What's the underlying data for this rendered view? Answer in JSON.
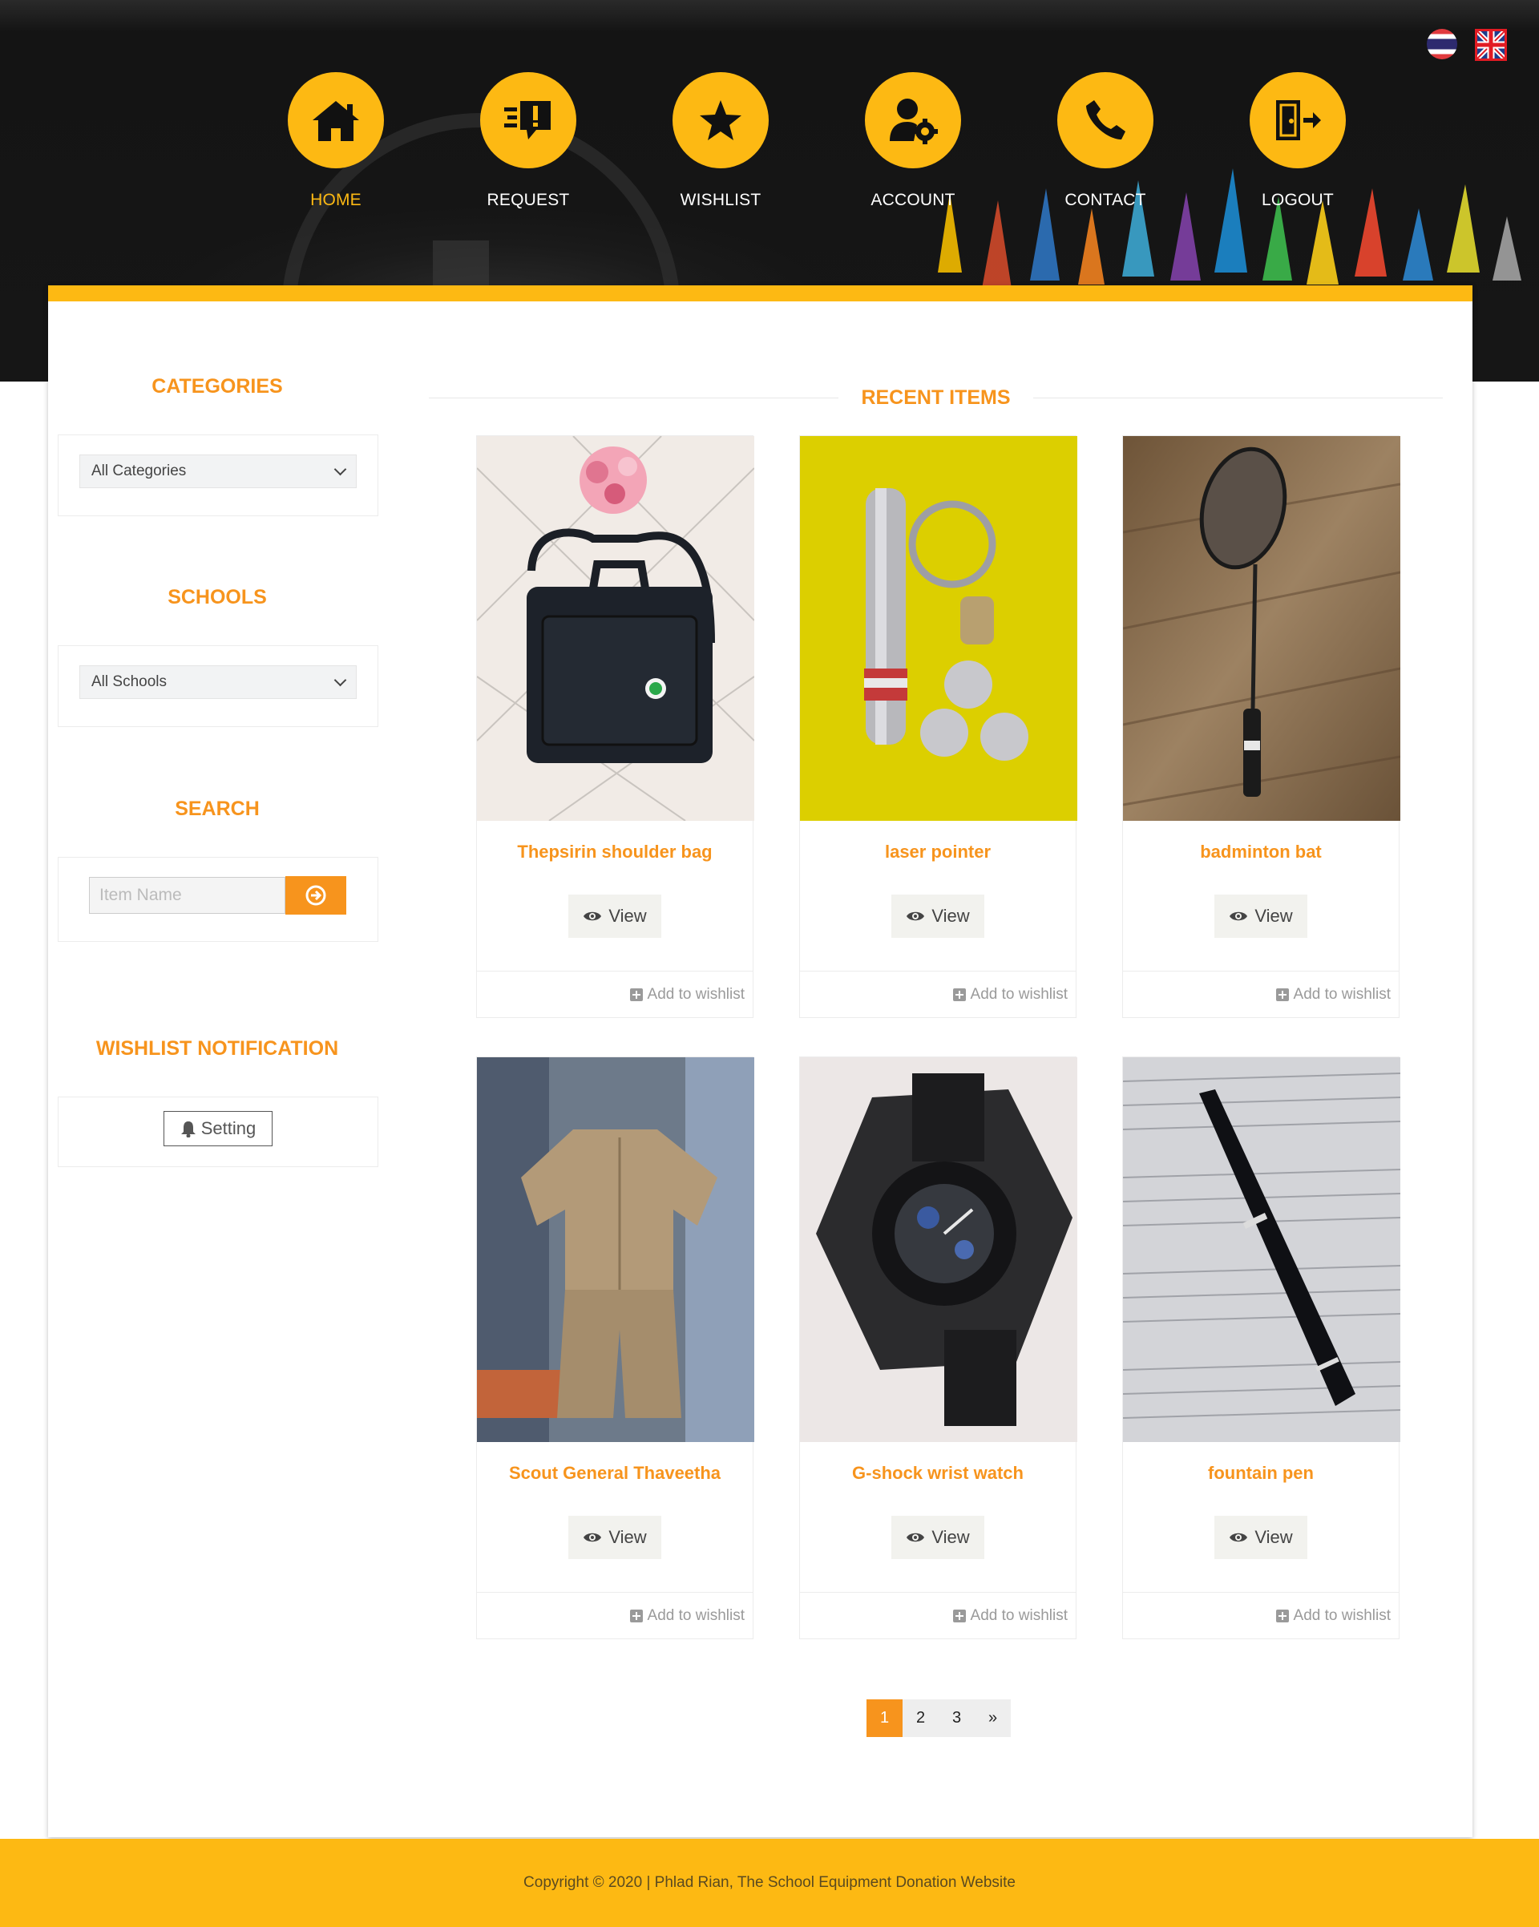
{
  "header": {
    "languages": [
      {
        "code": "th",
        "icon": "thailand-flag-icon"
      },
      {
        "code": "en",
        "icon": "uk-flag-icon"
      }
    ],
    "nav": [
      {
        "label": "HOME",
        "icon": "home-icon",
        "active": true
      },
      {
        "label": "REQUEST",
        "icon": "request-speech-icon",
        "active": false
      },
      {
        "label": "WISHLIST",
        "icon": "star-icon",
        "active": false
      },
      {
        "label": "ACCOUNT",
        "icon": "user-gear-icon",
        "active": false
      },
      {
        "label": "CONTACT",
        "icon": "phone-icon",
        "active": false
      },
      {
        "label": "LOGOUT",
        "icon": "door-exit-icon",
        "active": false
      }
    ],
    "accent_color": "#fdb913"
  },
  "sidebar": {
    "categories": {
      "title": "CATEGORIES",
      "selected": "All Categories"
    },
    "schools": {
      "title": "SCHOOLS",
      "selected": "All Schools"
    },
    "search": {
      "title": "SEARCH",
      "placeholder": "Item Name"
    },
    "wishlist_notification": {
      "title": "WISHLIST NOTIFICATION",
      "button_label": "Setting"
    }
  },
  "recent": {
    "title": "RECENT ITEMS",
    "view_label": "View",
    "wishlist_label": "Add to wishlist",
    "items": [
      {
        "name": "Thepsirin shoulder bag"
      },
      {
        "name": "laser pointer"
      },
      {
        "name": "badminton bat"
      },
      {
        "name": "Scout General Thaveetha"
      },
      {
        "name": "G-shock wrist watch"
      },
      {
        "name": "fountain pen"
      }
    ]
  },
  "pagination": {
    "pages": [
      "1",
      "2",
      "3",
      "»"
    ],
    "current": "1"
  },
  "footer": {
    "text": "Copyright © 2020 | Phlad Rian, The School Equipment Donation Website"
  },
  "colors": {
    "brand_yellow": "#fdb913",
    "title_orange": "#f7941d"
  }
}
